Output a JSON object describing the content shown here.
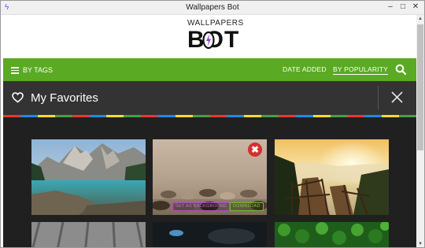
{
  "window": {
    "title": "Wallpapers Bot",
    "app_icon": "bolt-icon",
    "controls": {
      "minimize": "–",
      "maximize": "□",
      "close": "✕"
    }
  },
  "logo": {
    "top": "WALLPAPERS",
    "bottom": "BOT",
    "accent_color": "#8b3fd1"
  },
  "nav": {
    "tags_label": "BY TAGS",
    "date_label": "DATE ADDED",
    "popularity_label": "BY POPULARITY",
    "active_sort": "BY POPULARITY",
    "search_icon": "search-icon",
    "background_color": "#5aaa23"
  },
  "favorites": {
    "title": "My Favorites",
    "heart_icon": "heart-icon",
    "close_icon": "close-icon",
    "stripe_colors": [
      "#e53935",
      "#1e88e5",
      "#fdd835",
      "#43a047"
    ]
  },
  "wallpapers": [
    {
      "name": "Mountain lake"
    },
    {
      "name": "Pebbles",
      "hovered": true,
      "remove": "✖",
      "set_background": "SET AS BACKGROUND",
      "download": "DOWNLOAD"
    },
    {
      "name": "Wooden stairs sunset"
    },
    {
      "name": "Wooden boards"
    },
    {
      "name": "Dark device"
    },
    {
      "name": "Green clover"
    }
  ]
}
